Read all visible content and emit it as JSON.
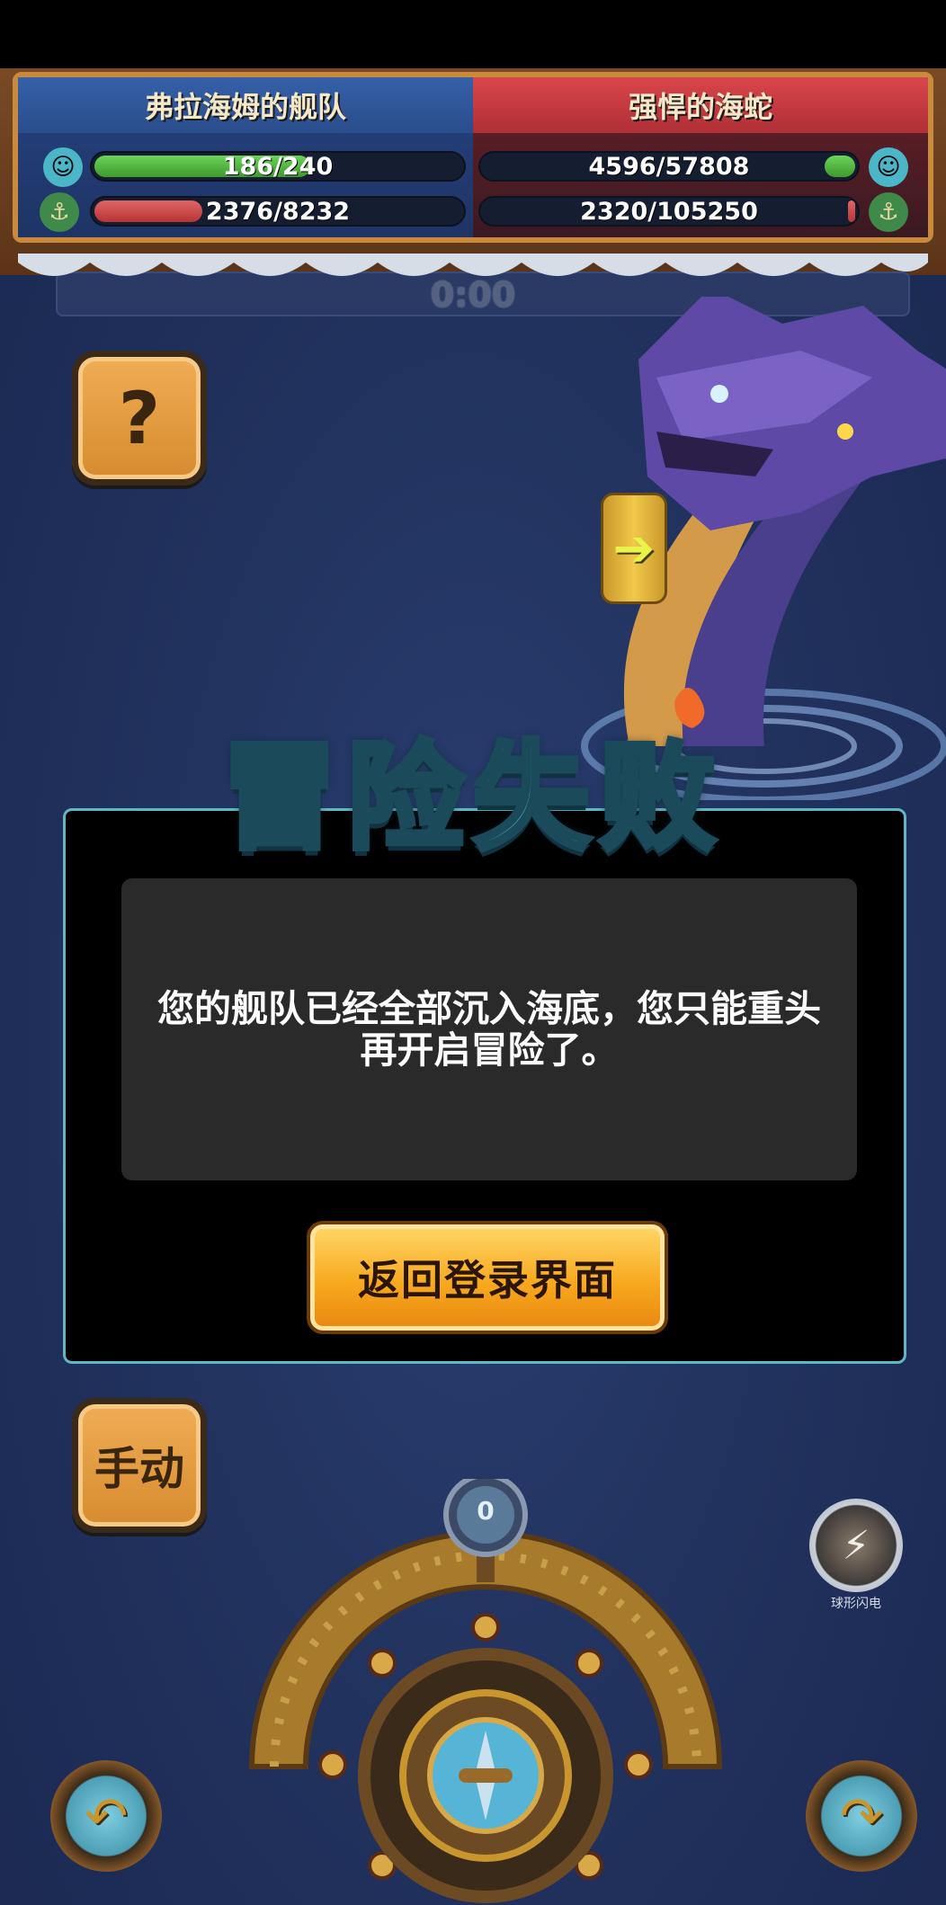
{
  "battle": {
    "left_team": {
      "name": "弗拉海姆的舰队",
      "crew": {
        "text": "186/240",
        "current": 186,
        "max": 240
      },
      "ship": {
        "text": "2376/8232",
        "current": 2376,
        "max": 8232
      }
    },
    "right_team": {
      "name": "强悍的海蛇",
      "crew": {
        "text": "4596/57808",
        "current": 4596,
        "max": 57808
      },
      "ship": {
        "text": "2320/105250",
        "current": 2320,
        "max": 105250
      }
    },
    "timer": "0:00"
  },
  "buttons": {
    "help_label": "?",
    "manual_label": "手动",
    "ability_label": "球形闪电",
    "power_count": "0"
  },
  "dialog": {
    "title": "冒险失败",
    "message": "您的舰队已经全部沉入海底，您只能重头再开启冒险了。",
    "return_button": "返回登录界面"
  },
  "icons": {
    "crew": "sailor-icon",
    "ship": "ship-icon",
    "undo": "undo-arrow-icon",
    "redo": "redo-arrow-icon",
    "expand": "arrow-right-icon",
    "ability": "lightning-ball-icon"
  },
  "colors": {
    "left_header": "#2a4d8b",
    "right_header": "#b02f36",
    "crew_bar": "#4caf38",
    "ship_bar": "#d04040",
    "dialog_border": "#5fb8c6",
    "title_text": "#58c4d8",
    "button_orange": "#f8a91e"
  }
}
